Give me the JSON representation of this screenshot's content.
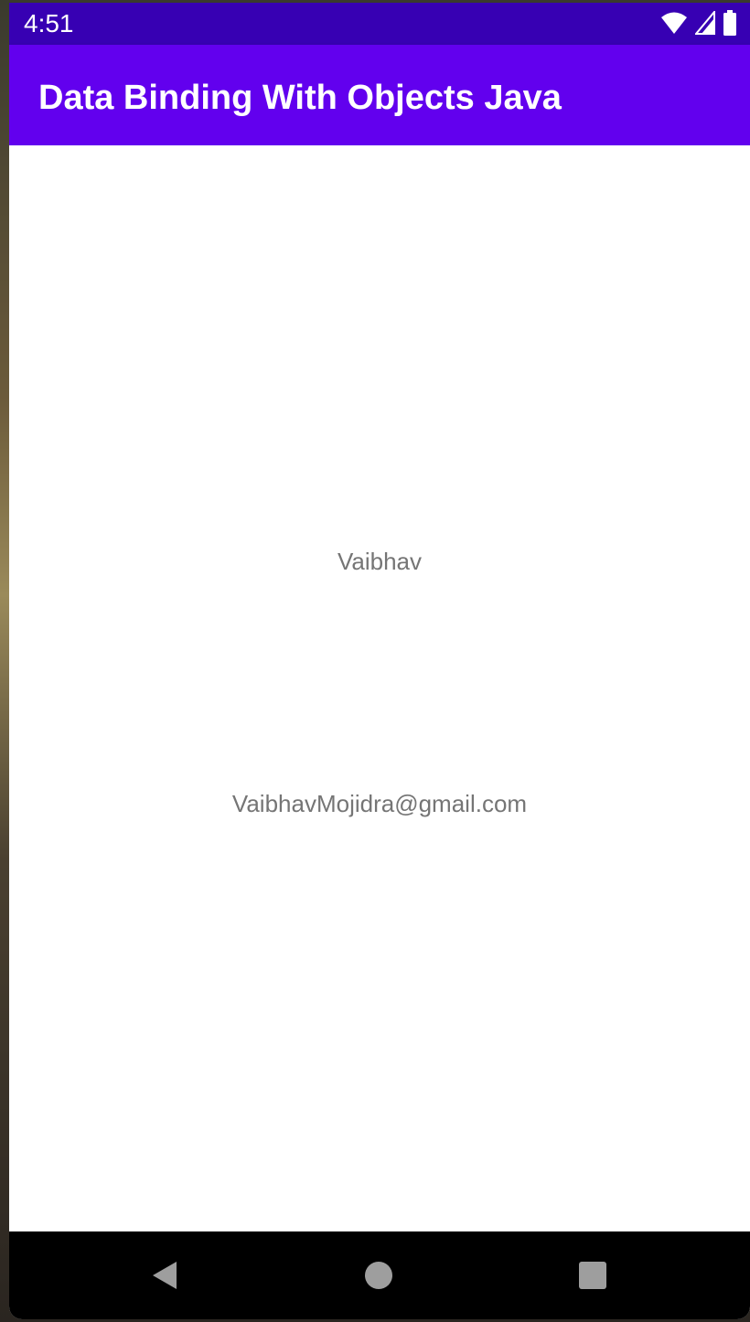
{
  "status_bar": {
    "time": "4:51",
    "icons": [
      "wifi-icon",
      "signal-icon",
      "battery-icon"
    ],
    "background": "#3700B3"
  },
  "app_bar": {
    "title": "Data Binding With Objects Java",
    "background": "#6200EE"
  },
  "content": {
    "name": "Vaibhav",
    "email": "VaibhavMojidra@gmail.com",
    "text_color": "#757575"
  },
  "nav_bar": {
    "buttons": [
      "back-icon",
      "home-icon",
      "recents-icon"
    ]
  }
}
